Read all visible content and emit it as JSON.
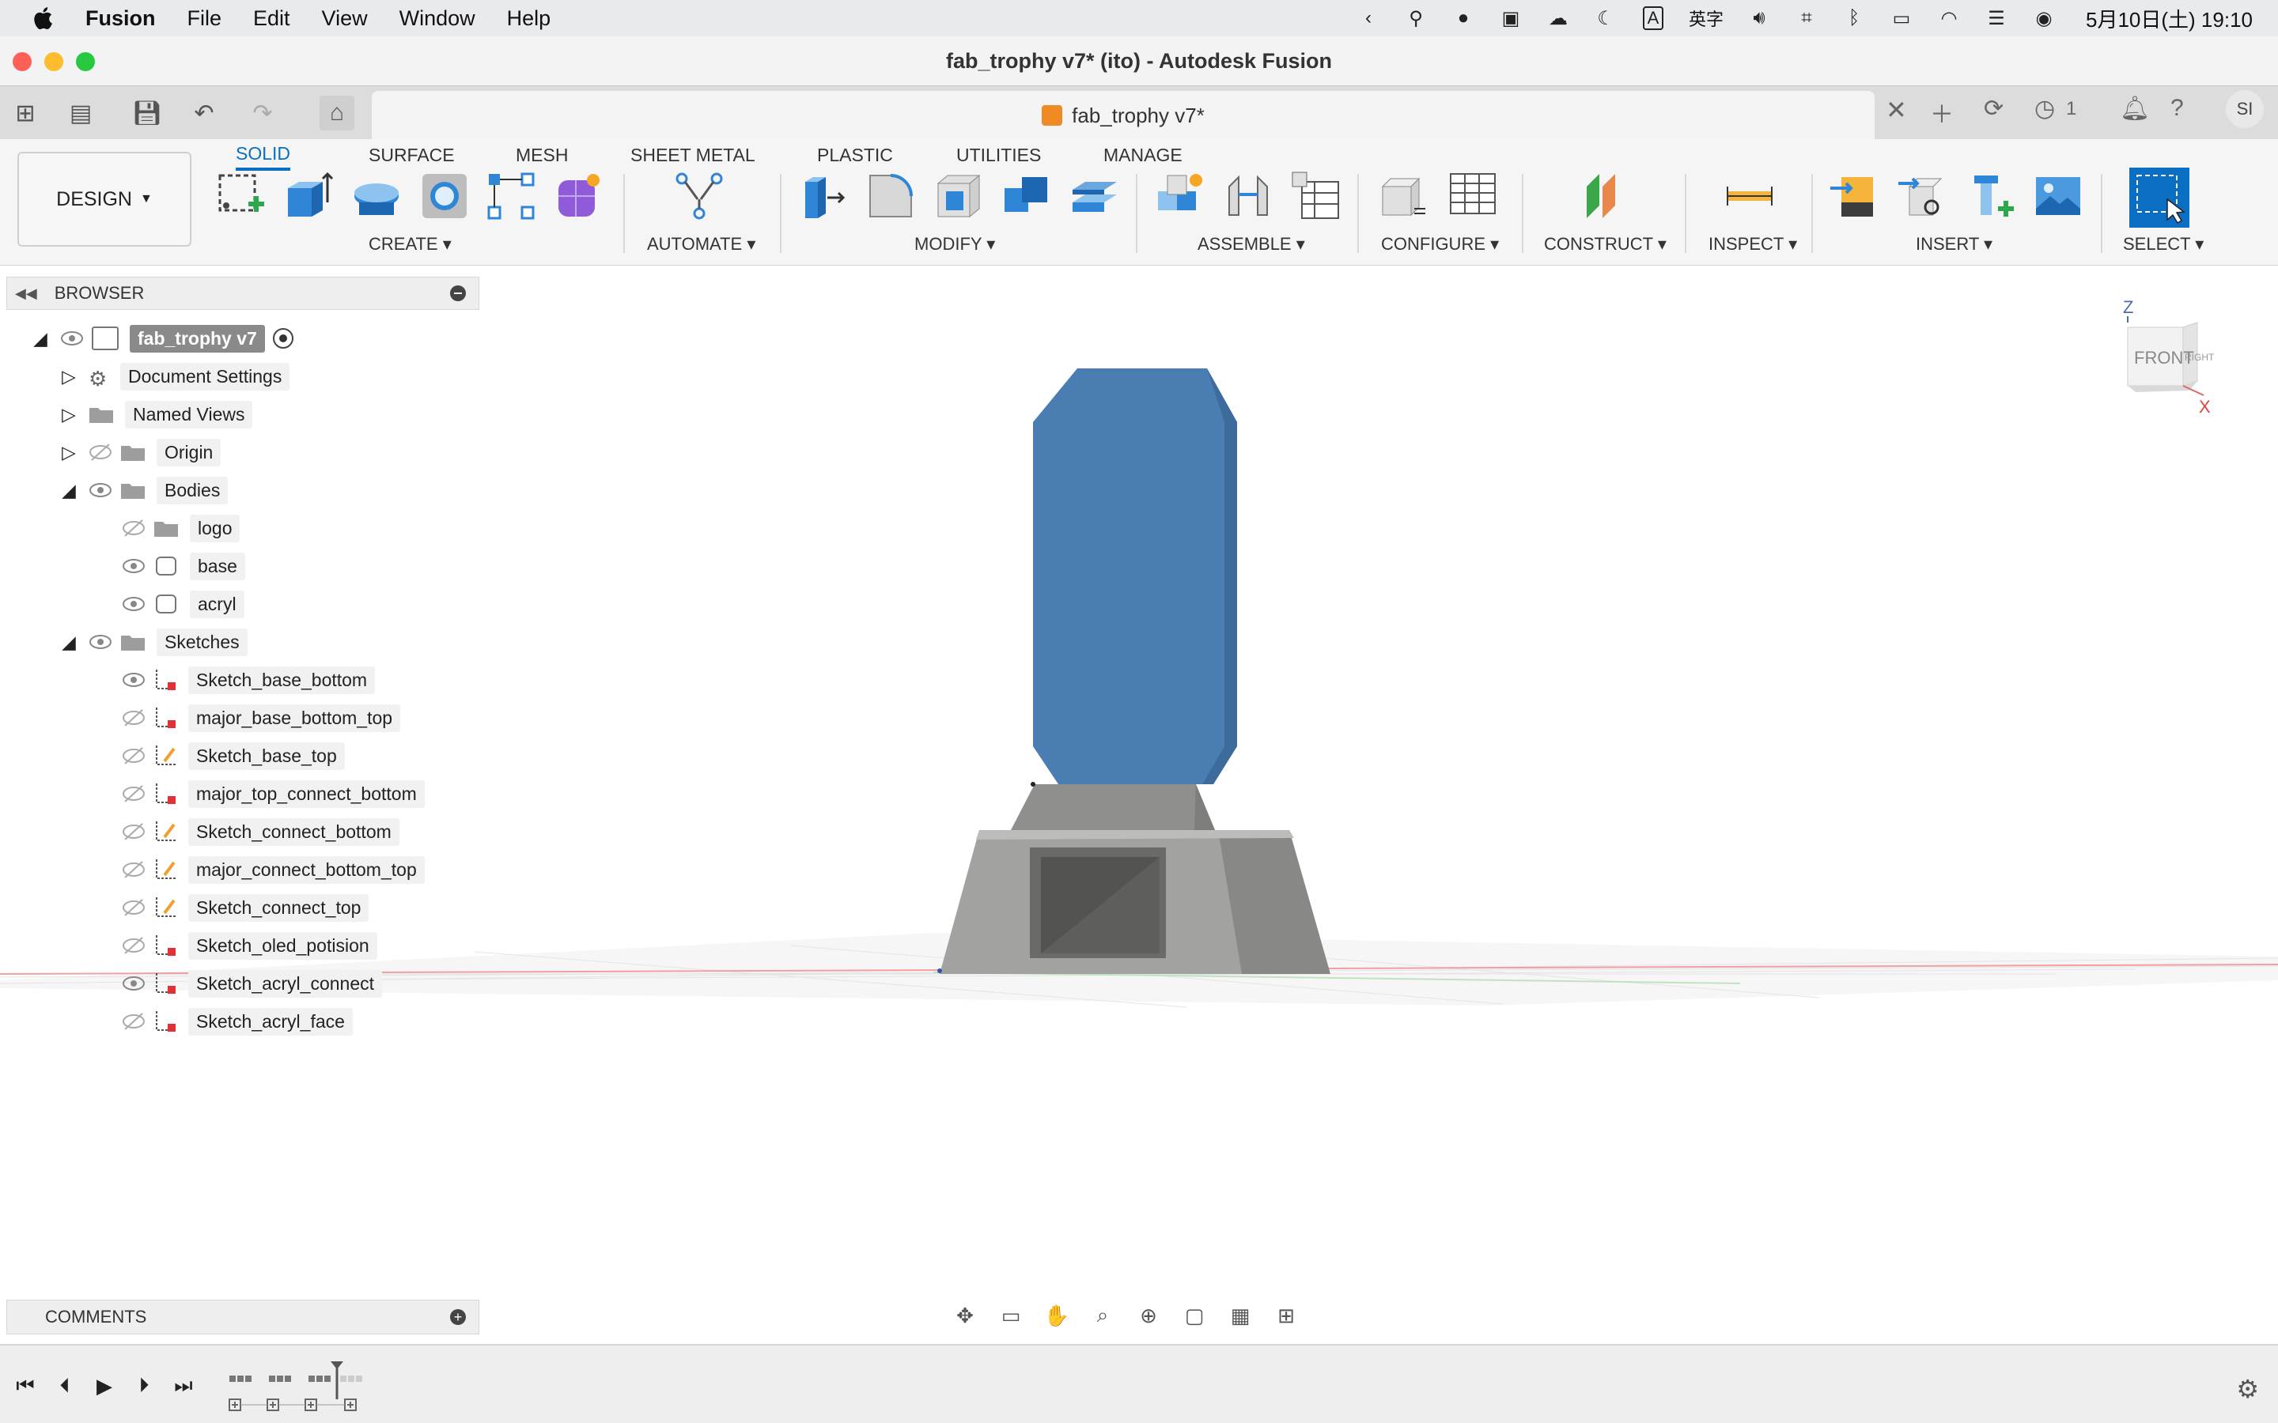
{
  "menubar": {
    "items": [
      "Fusion",
      "File",
      "Edit",
      "View",
      "Window",
      "Help"
    ],
    "ime_label": "A",
    "ime_text": "英字",
    "clock": "5月10日(土)  19:10"
  },
  "window": {
    "title": "fab_trophy v7* (ito) - Autodesk Fusion"
  },
  "tabbar": {
    "doc_tab_title": "fab_trophy v7*",
    "job_count": "1",
    "avatar_initials": "SI"
  },
  "ribbon": {
    "workspace": "DESIGN",
    "tabs": [
      "SOLID",
      "SURFACE",
      "MESH",
      "SHEET METAL",
      "PLASTIC",
      "UTILITIES",
      "MANAGE"
    ],
    "groups": [
      "CREATE",
      "AUTOMATE",
      "MODIFY",
      "ASSEMBLE",
      "CONFIGURE",
      "CONSTRUCT",
      "INSPECT",
      "INSERT",
      "SELECT"
    ],
    "accent_color": "#0a6fc2"
  },
  "browser": {
    "title": "BROWSER",
    "root": "fab_trophy v7",
    "items": [
      {
        "label": "Document Settings",
        "icon": "gear-icon"
      },
      {
        "label": "Named Views",
        "icon": "folder-icon"
      },
      {
        "label": "Origin",
        "icon": "folder-icon"
      },
      {
        "label": "Bodies",
        "icon": "folder-icon"
      }
    ],
    "bodies": [
      "logo",
      "base",
      "acryl"
    ],
    "sketches_label": "Sketches",
    "sketches": [
      "Sketch_base_bottom",
      "major_base_bottom_top",
      "Sketch_base_top",
      "major_top_connect_bottom",
      "Sketch_connect_bottom",
      "major_connect_bottom_top",
      "Sketch_connect_top",
      "Sketch_oled_potision",
      "Sketch_acryl_connect",
      "Sketch_acryl_face"
    ]
  },
  "viewcube": {
    "front": "FRONT",
    "right": "RIGHT",
    "z": "Z",
    "x": "X"
  },
  "comments": {
    "title": "COMMENTS"
  },
  "colors": {
    "acryl_body": "#4a7eb3",
    "base_body": "#9a9a98"
  }
}
